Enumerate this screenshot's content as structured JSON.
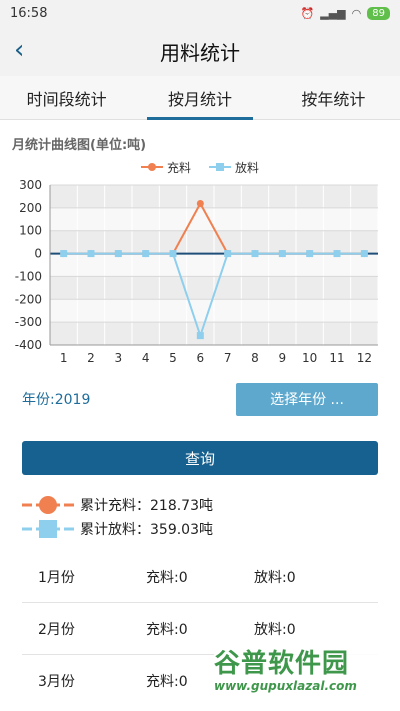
{
  "status": {
    "time": "16:58",
    "battery": "89"
  },
  "header": {
    "back_icon": "‹",
    "title": "用料统计"
  },
  "tabs": [
    {
      "label": "时间段统计",
      "active": false
    },
    {
      "label": "按月统计",
      "active": true
    },
    {
      "label": "按年统计",
      "active": false
    }
  ],
  "section_title": "月统计曲线图(单位:吨)",
  "chart_data": {
    "type": "line",
    "title": "月统计曲线图(单位:吨)",
    "x": [
      "1",
      "2",
      "3",
      "4",
      "5",
      "6",
      "7",
      "8",
      "9",
      "10",
      "11",
      "12"
    ],
    "ylim": [
      -400,
      300
    ],
    "yticks": [
      "300",
      "200",
      "100",
      "0",
      "-100",
      "-200",
      "-300",
      "-400"
    ],
    "ytick_values": [
      300,
      200,
      100,
      0,
      -100,
      -200,
      -300,
      -400
    ],
    "grid": true,
    "legend_position": "top-center",
    "series": [
      {
        "name": "充料",
        "color": "#f08050",
        "marker": "circle",
        "values": [
          0,
          0,
          0,
          0,
          0,
          219,
          0,
          0,
          0,
          0,
          0,
          0
        ]
      },
      {
        "name": "放料",
        "color": "#8ecfee",
        "marker": "square",
        "values": [
          0,
          0,
          0,
          0,
          0,
          -359,
          0,
          0,
          0,
          0,
          0,
          0
        ]
      }
    ]
  },
  "year": {
    "label": "年份:2019",
    "button": "选择年份 ..."
  },
  "query_button": "查询",
  "summary": {
    "charge": "累计充料：218.73吨",
    "discharge": "累计放料：359.03吨"
  },
  "months": [
    {
      "month": "1月份",
      "charge": "充料:0",
      "discharge": "放料:0"
    },
    {
      "month": "2月份",
      "charge": "充料:0",
      "discharge": "放料:0"
    },
    {
      "month": "3月份",
      "charge": "充料:0",
      "discharge": ""
    }
  ],
  "watermark": {
    "name": "谷普软件园",
    "url": "www.gupuxlazal.com"
  }
}
